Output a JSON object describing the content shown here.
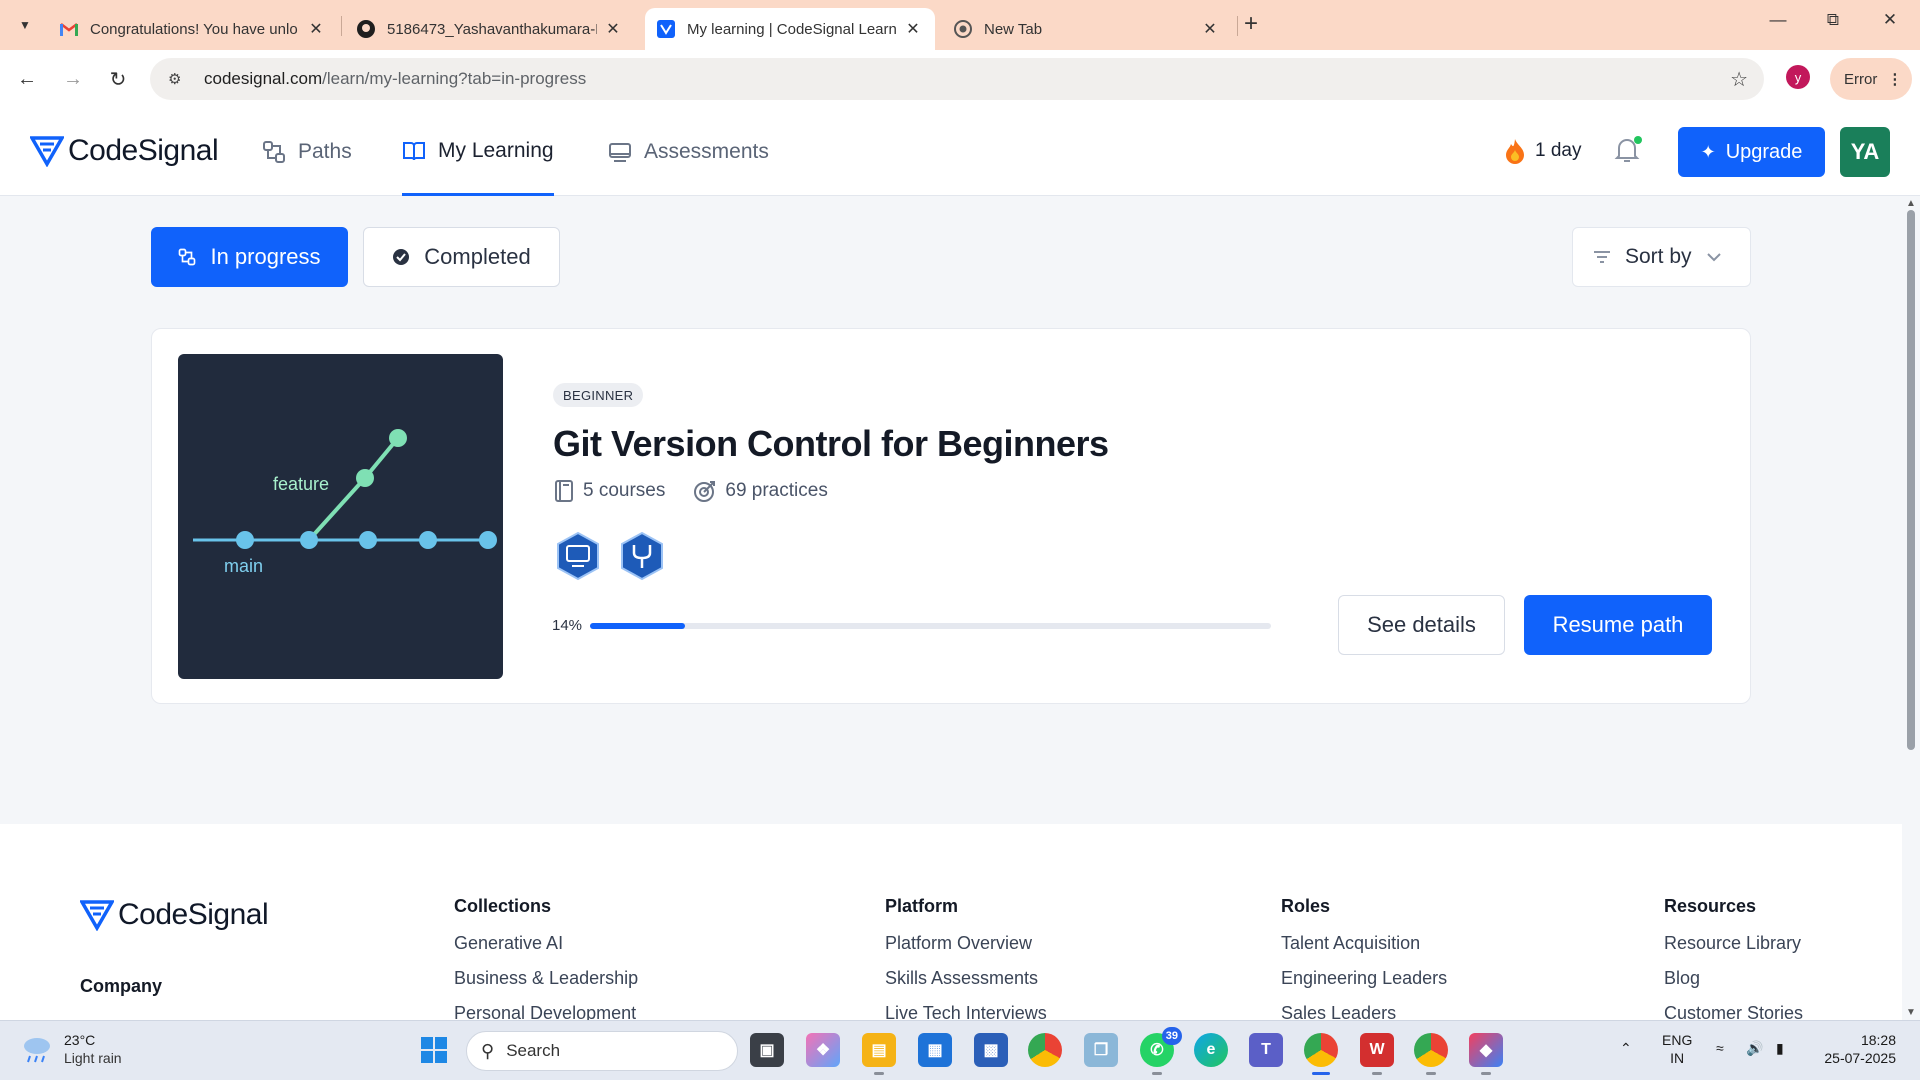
{
  "browser": {
    "tabs": [
      {
        "title": "Congratulations! You have unlo",
        "favicon": "gmail-icon"
      },
      {
        "title": "5186473_Yashavanthakumara-H",
        "favicon": "github-icon"
      },
      {
        "title": "My learning | CodeSignal Learn",
        "favicon": "codesignal-icon",
        "active": true
      },
      {
        "title": "New Tab",
        "favicon": "chrome-icon"
      }
    ],
    "url_host": "codesignal.com",
    "url_path": "/learn/my-learning?tab=in-progress",
    "profile_initial": "y",
    "error_label": "Error"
  },
  "header": {
    "brand": "CodeSignal",
    "nav": [
      {
        "label": "Paths",
        "icon": "paths-icon"
      },
      {
        "label": "My Learning",
        "icon": "book-icon",
        "active": true
      },
      {
        "label": "Assessments",
        "icon": "monitor-icon"
      }
    ],
    "streak": "1 day",
    "upgrade_label": "Upgrade",
    "avatar_initials": "YA"
  },
  "filters": {
    "in_progress": "In progress",
    "completed": "Completed",
    "sort_by": "Sort by"
  },
  "path_card": {
    "thumbnail": {
      "branch_label": "feature",
      "main_label": "main"
    },
    "level": "BEGINNER",
    "title": "Git Version Control for Beginners",
    "courses": "5 courses",
    "practices": "69 practices",
    "badges": [
      "monitor-badge-icon",
      "git-branch-badge-icon"
    ],
    "progress_label": "14%",
    "progress": 0.14,
    "see_details_label": "See details",
    "resume_label": "Resume path"
  },
  "footer": {
    "brand": "CodeSignal",
    "company": "Company",
    "columns": [
      {
        "heading": "Collections",
        "links": [
          "Generative AI",
          "Business & Leadership",
          "Personal Development"
        ]
      },
      {
        "heading": "Platform",
        "links": [
          "Platform Overview",
          "Skills Assessments",
          "Live Tech Interviews"
        ]
      },
      {
        "heading": "Roles",
        "links": [
          "Talent Acquisition",
          "Engineering Leaders",
          "Sales Leaders"
        ]
      },
      {
        "heading": "Resources",
        "links": [
          "Resource Library",
          "Blog",
          "Customer Stories"
        ]
      }
    ]
  },
  "taskbar": {
    "weather_temp": "23°C",
    "weather_desc": "Light rain",
    "search_placeholder": "Search",
    "whatsapp_badge": "39",
    "lang_top": "ENG",
    "lang_bottom": "IN",
    "time": "18:28",
    "date": "25-07-2025"
  },
  "colors": {
    "accent": "#1062fb",
    "thumbnail_bg": "#212b3d",
    "graph_line": "#7fe0b4",
    "graph_main": "#69c3ea"
  }
}
